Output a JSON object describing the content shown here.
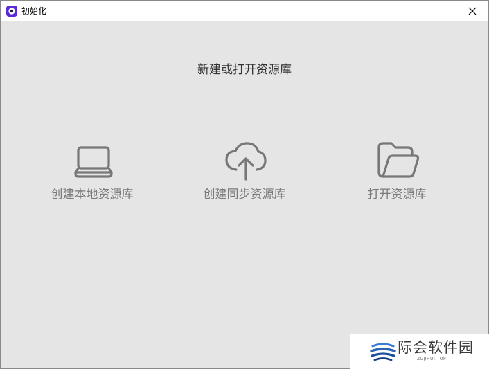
{
  "window": {
    "title": "初始化"
  },
  "main": {
    "heading": "新建或打开资源库",
    "options": [
      {
        "label": "创建本地资源库",
        "icon": "laptop-icon"
      },
      {
        "label": "创建同步资源库",
        "icon": "cloud-upload-icon"
      },
      {
        "label": "打开资源库",
        "icon": "folder-open-icon"
      }
    ]
  },
  "watermark": {
    "text": "际会软件园",
    "sub": "ZUJIHUI.TOP"
  },
  "colors": {
    "titlebar_bg": "#ffffff",
    "content_bg": "#e5e5e5",
    "heading_text": "#333333",
    "option_text": "#7a7a7a",
    "icon_stroke": "#777777",
    "app_icon_accent": "#5b2bd6"
  }
}
